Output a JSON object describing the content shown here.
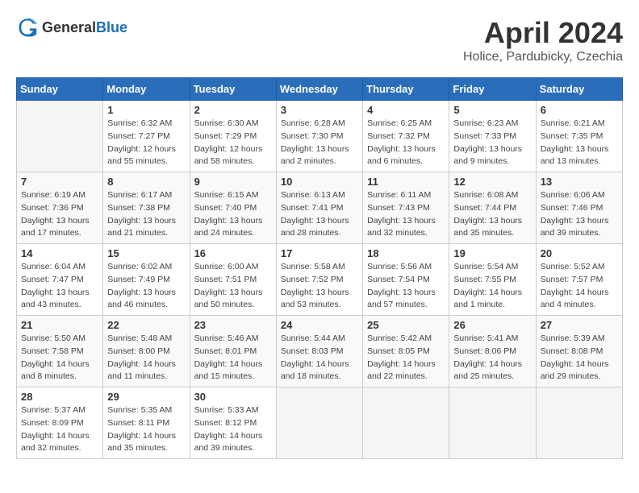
{
  "header": {
    "logo_general": "General",
    "logo_blue": "Blue",
    "title": "April 2024",
    "subtitle": "Holice, Pardubicky, Czechia"
  },
  "calendar": {
    "weekdays": [
      "Sunday",
      "Monday",
      "Tuesday",
      "Wednesday",
      "Thursday",
      "Friday",
      "Saturday"
    ],
    "weeks": [
      [
        {
          "day": "",
          "info": ""
        },
        {
          "day": "1",
          "info": "Sunrise: 6:32 AM\nSunset: 7:27 PM\nDaylight: 12 hours\nand 55 minutes."
        },
        {
          "day": "2",
          "info": "Sunrise: 6:30 AM\nSunset: 7:29 PM\nDaylight: 12 hours\nand 58 minutes."
        },
        {
          "day": "3",
          "info": "Sunrise: 6:28 AM\nSunset: 7:30 PM\nDaylight: 13 hours\nand 2 minutes."
        },
        {
          "day": "4",
          "info": "Sunrise: 6:25 AM\nSunset: 7:32 PM\nDaylight: 13 hours\nand 6 minutes."
        },
        {
          "day": "5",
          "info": "Sunrise: 6:23 AM\nSunset: 7:33 PM\nDaylight: 13 hours\nand 9 minutes."
        },
        {
          "day": "6",
          "info": "Sunrise: 6:21 AM\nSunset: 7:35 PM\nDaylight: 13 hours\nand 13 minutes."
        }
      ],
      [
        {
          "day": "7",
          "info": "Sunrise: 6:19 AM\nSunset: 7:36 PM\nDaylight: 13 hours\nand 17 minutes."
        },
        {
          "day": "8",
          "info": "Sunrise: 6:17 AM\nSunset: 7:38 PM\nDaylight: 13 hours\nand 21 minutes."
        },
        {
          "day": "9",
          "info": "Sunrise: 6:15 AM\nSunset: 7:40 PM\nDaylight: 13 hours\nand 24 minutes."
        },
        {
          "day": "10",
          "info": "Sunrise: 6:13 AM\nSunset: 7:41 PM\nDaylight: 13 hours\nand 28 minutes."
        },
        {
          "day": "11",
          "info": "Sunrise: 6:11 AM\nSunset: 7:43 PM\nDaylight: 13 hours\nand 32 minutes."
        },
        {
          "day": "12",
          "info": "Sunrise: 6:08 AM\nSunset: 7:44 PM\nDaylight: 13 hours\nand 35 minutes."
        },
        {
          "day": "13",
          "info": "Sunrise: 6:06 AM\nSunset: 7:46 PM\nDaylight: 13 hours\nand 39 minutes."
        }
      ],
      [
        {
          "day": "14",
          "info": "Sunrise: 6:04 AM\nSunset: 7:47 PM\nDaylight: 13 hours\nand 43 minutes."
        },
        {
          "day": "15",
          "info": "Sunrise: 6:02 AM\nSunset: 7:49 PM\nDaylight: 13 hours\nand 46 minutes."
        },
        {
          "day": "16",
          "info": "Sunrise: 6:00 AM\nSunset: 7:51 PM\nDaylight: 13 hours\nand 50 minutes."
        },
        {
          "day": "17",
          "info": "Sunrise: 5:58 AM\nSunset: 7:52 PM\nDaylight: 13 hours\nand 53 minutes."
        },
        {
          "day": "18",
          "info": "Sunrise: 5:56 AM\nSunset: 7:54 PM\nDaylight: 13 hours\nand 57 minutes."
        },
        {
          "day": "19",
          "info": "Sunrise: 5:54 AM\nSunset: 7:55 PM\nDaylight: 14 hours\nand 1 minute."
        },
        {
          "day": "20",
          "info": "Sunrise: 5:52 AM\nSunset: 7:57 PM\nDaylight: 14 hours\nand 4 minutes."
        }
      ],
      [
        {
          "day": "21",
          "info": "Sunrise: 5:50 AM\nSunset: 7:58 PM\nDaylight: 14 hours\nand 8 minutes."
        },
        {
          "day": "22",
          "info": "Sunrise: 5:48 AM\nSunset: 8:00 PM\nDaylight: 14 hours\nand 11 minutes."
        },
        {
          "day": "23",
          "info": "Sunrise: 5:46 AM\nSunset: 8:01 PM\nDaylight: 14 hours\nand 15 minutes."
        },
        {
          "day": "24",
          "info": "Sunrise: 5:44 AM\nSunset: 8:03 PM\nDaylight: 14 hours\nand 18 minutes."
        },
        {
          "day": "25",
          "info": "Sunrise: 5:42 AM\nSunset: 8:05 PM\nDaylight: 14 hours\nand 22 minutes."
        },
        {
          "day": "26",
          "info": "Sunrise: 5:41 AM\nSunset: 8:06 PM\nDaylight: 14 hours\nand 25 minutes."
        },
        {
          "day": "27",
          "info": "Sunrise: 5:39 AM\nSunset: 8:08 PM\nDaylight: 14 hours\nand 29 minutes."
        }
      ],
      [
        {
          "day": "28",
          "info": "Sunrise: 5:37 AM\nSunset: 8:09 PM\nDaylight: 14 hours\nand 32 minutes."
        },
        {
          "day": "29",
          "info": "Sunrise: 5:35 AM\nSunset: 8:11 PM\nDaylight: 14 hours\nand 35 minutes."
        },
        {
          "day": "30",
          "info": "Sunrise: 5:33 AM\nSunset: 8:12 PM\nDaylight: 14 hours\nand 39 minutes."
        },
        {
          "day": "",
          "info": ""
        },
        {
          "day": "",
          "info": ""
        },
        {
          "day": "",
          "info": ""
        },
        {
          "day": "",
          "info": ""
        }
      ]
    ]
  }
}
